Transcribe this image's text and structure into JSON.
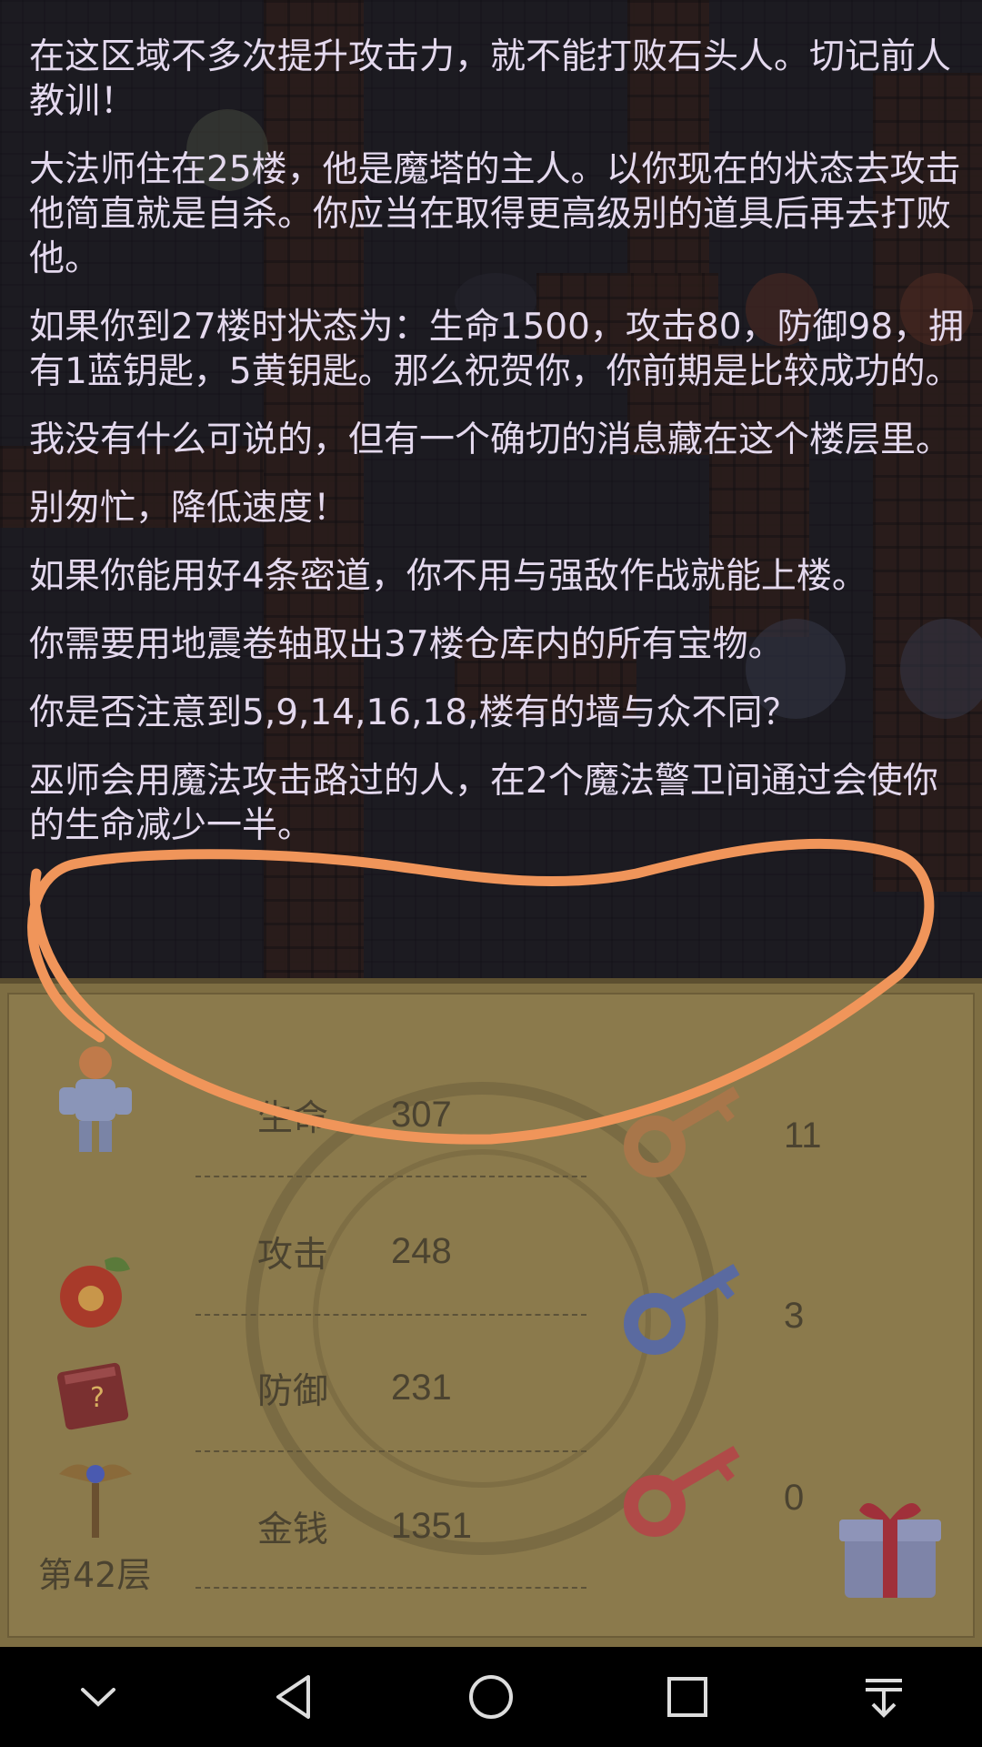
{
  "messages": [
    "在这区域不多次提升攻击力，就不能打败石头人。切记前人教训！",
    "大法师住在25楼，他是魔塔的主人。以你现在的状态去攻击他简直就是自杀。你应当在取得更高级别的道具后再去打败他。",
    "如果你到27楼时状态为：生命1500，攻击80，防御98，拥有1蓝钥匙，5黄钥匙。那么祝贺你，你前期是比较成功的。",
    "我没有什么可说的，但有一个确切的消息藏在这个楼层里。",
    "别匆忙，降低速度！",
    "如果你能用好4条密道，你不用与强敌作战就能上楼。",
    "你需要用地震卷轴取出37楼仓库内的所有宝物。",
    "你是否注意到5,9,14,16,18,楼有的墙与众不同？",
    "巫师会用魔法攻击路过的人，在2个魔法警卫间通过会使你的生命减少一半。"
  ],
  "stats": {
    "hp": {
      "label": "生命",
      "value": "307"
    },
    "attack": {
      "label": "攻击",
      "value": "248"
    },
    "defense": {
      "label": "防御",
      "value": "231"
    },
    "gold": {
      "label": "金钱",
      "value": "1351"
    }
  },
  "keys": {
    "yellow": {
      "count": "11",
      "color": "#c9954c"
    },
    "blue": {
      "count": "3",
      "color": "#6a7fc6"
    },
    "red": {
      "count": "0",
      "color": "#c85a58"
    }
  },
  "floor": "第42层",
  "icons": {
    "hero": "knight-hero-icon",
    "bag": "lucky-bag-icon",
    "book": "monster-manual-icon",
    "staff": "winged-staff-icon",
    "gift": "gift-box-icon"
  },
  "colors": {
    "annotation": "#f0955a",
    "panel": "#8b7a4c",
    "text": "#e4d9ee"
  }
}
